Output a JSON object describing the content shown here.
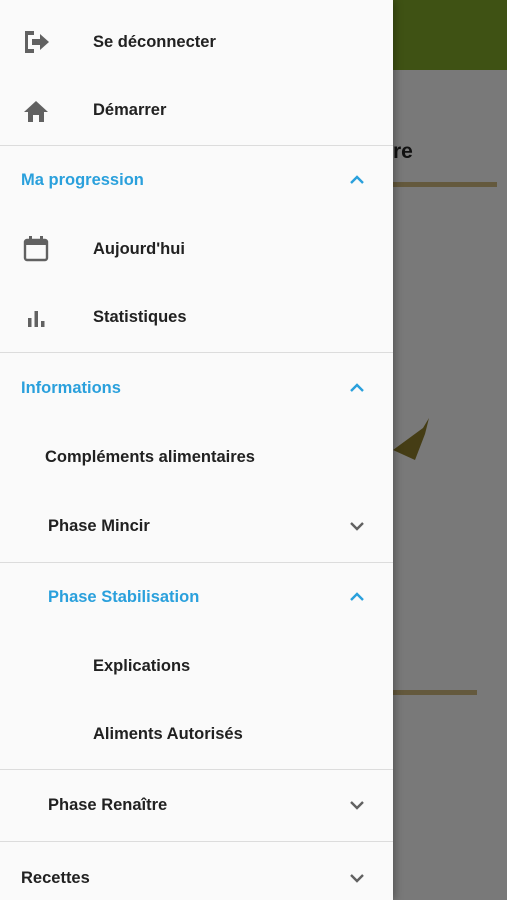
{
  "background": {
    "title_fragment": "re"
  },
  "drawer": {
    "items": [
      {
        "label": "Se déconnecter",
        "icon": "logout-icon"
      },
      {
        "label": "Démarrer",
        "icon": "home-icon"
      }
    ],
    "sections": {
      "progression": {
        "label": "Ma progression",
        "expanded": true,
        "items": [
          {
            "label": "Aujourd'hui",
            "icon": "calendar-icon"
          },
          {
            "label": "Statistiques",
            "icon": "bar-chart-icon"
          }
        ]
      },
      "informations": {
        "label": "Informations",
        "expanded": true,
        "complements": "Compléments alimentaires",
        "phase_mincir": {
          "label": "Phase Mincir",
          "expanded": false
        },
        "phase_stabilisation": {
          "label": "Phase Stabilisation",
          "expanded": true,
          "items": [
            {
              "label": "Explications"
            },
            {
              "label": "Aliments Autorisés"
            }
          ]
        },
        "phase_renaitre": {
          "label": "Phase Renaître",
          "expanded": false
        }
      },
      "recettes": {
        "label": "Recettes",
        "expanded": false
      }
    }
  },
  "colors": {
    "accent": "#2aa0dc",
    "appbar": "#7ea529",
    "icon": "#616161"
  }
}
